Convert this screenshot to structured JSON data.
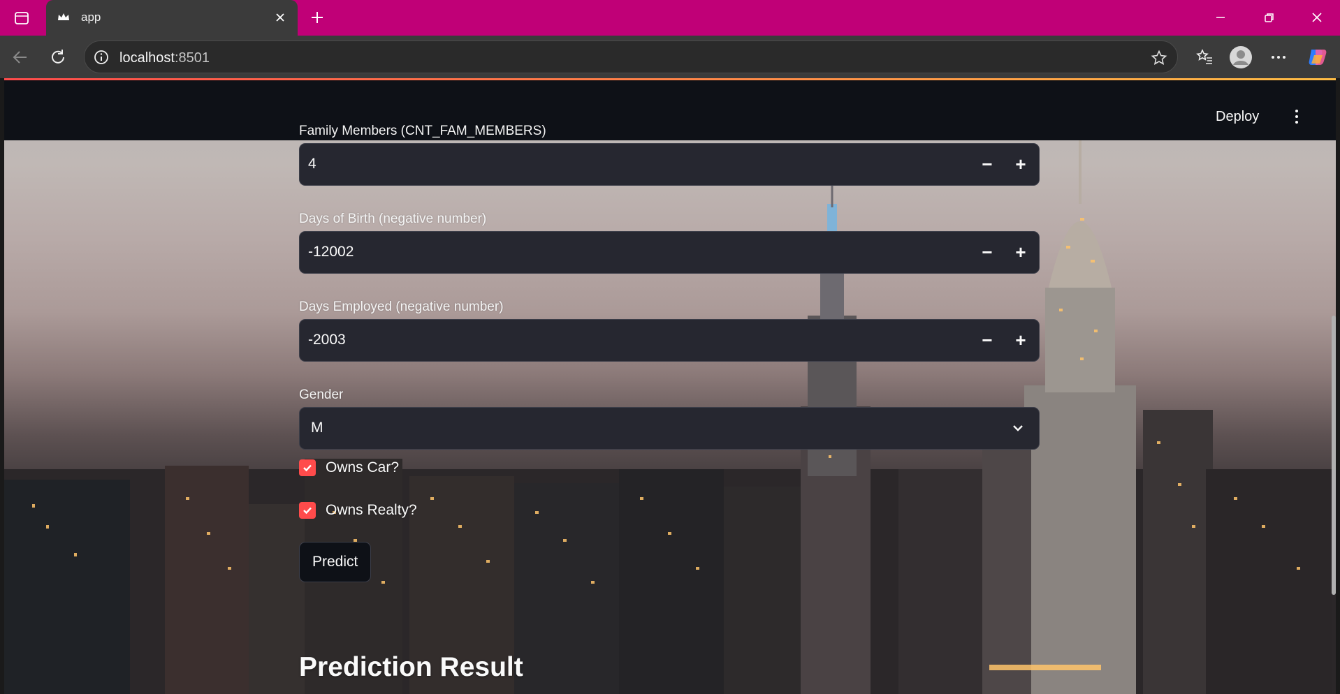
{
  "browser": {
    "tab_title": "app",
    "url_host": "localhost",
    "url_port": ":8501"
  },
  "header": {
    "deploy_label": "Deploy"
  },
  "form": {
    "family_members": {
      "label": "Family Members (CNT_FAM_MEMBERS)",
      "value": "4"
    },
    "days_birth": {
      "label": "Days of Birth (negative number)",
      "value": "-12002"
    },
    "days_employed": {
      "label": "Days Employed (negative number)",
      "value": "-2003"
    },
    "gender": {
      "label": "Gender",
      "value": "M"
    },
    "owns_car": {
      "label": "Owns Car?",
      "checked": true
    },
    "owns_realty": {
      "label": "Owns Realty?",
      "checked": true
    },
    "predict_label": "Predict",
    "steppers": {
      "minus": "−",
      "plus": "+"
    }
  },
  "result": {
    "title": "Prediction Result"
  },
  "colors": {
    "tab_bar": "#c00077",
    "streamlit_accent": "#ff4b4b",
    "input_bg": "#262730",
    "header_bg": "#0e1117"
  }
}
